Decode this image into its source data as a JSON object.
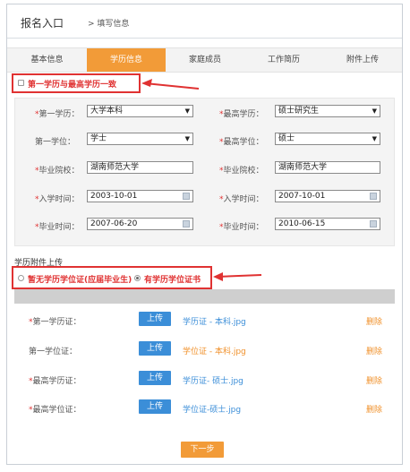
{
  "breadcrumb": {
    "root": "报名入口",
    "current": "> 填写信息"
  },
  "tabs": [
    "基本信息",
    "学历信息",
    "家庭成员",
    "工作简历",
    "附件上传"
  ],
  "same_degree_checkbox": "第一学历与最高学历一致",
  "fields": {
    "first_edu_label": "第一学历：",
    "first_edu_value": "大学本科",
    "highest_edu_label": "最高学历：",
    "highest_edu_value": "硕士研究生",
    "first_degree_label": "第一学位：",
    "first_degree_value": "学士",
    "highest_degree_label": "最高学位：",
    "highest_degree_value": "硕士",
    "school1_label": "毕业院校：",
    "school1_value": "湖南师范大学",
    "school2_label": "毕业院校：",
    "school2_value": "湖南师范大学",
    "enroll1_label": "入学时间：",
    "enroll1_value": "2003-10-01",
    "enroll2_label": "入学时间：",
    "enroll2_value": "2007-10-01",
    "grad1_label": "毕业时间：",
    "grad1_value": "2007-06-20",
    "grad2_label": "毕业时间：",
    "grad2_value": "2010-06-15"
  },
  "attach_section_title": "学历附件上传",
  "radio_none": "暂无学历学位证(应届毕业生)",
  "radio_has": "有学历学位证书",
  "uploads": [
    {
      "label": "第一学历证：",
      "required": "*",
      "button": "上传",
      "file": "学历证 - 本科.jpg",
      "delete": "删除"
    },
    {
      "label": "第一学位证：",
      "required": "",
      "button": "上传",
      "file": "学位证 - 本科.jpg",
      "delete": "删除"
    },
    {
      "label": "最高学历证：",
      "required": "*",
      "button": "上传",
      "file": "学历证- 硕士.jpg",
      "delete": "删除"
    },
    {
      "label": "最高学位证：",
      "required": "*",
      "button": "上传",
      "file": "学位证-硕士.jpg",
      "delete": "删除"
    }
  ],
  "next_button": "下一步",
  "colors": {
    "accent": "#f29b38",
    "highlight": "#e03232",
    "upload_button": "#3b8ed8"
  },
  "icons": {
    "dropdown": "chevron-down-icon",
    "calendar": "calendar-icon",
    "arrow": "red-arrow-icon"
  }
}
